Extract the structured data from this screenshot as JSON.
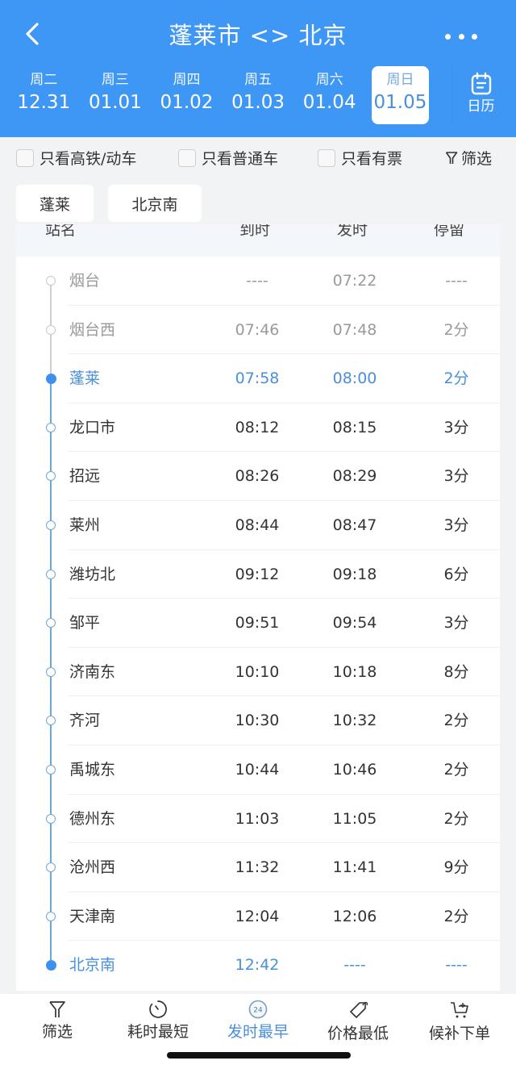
{
  "header": {
    "title": "蓬莱市 <> 北京",
    "back_icon": "chevron-left-icon",
    "more_icon": "more-dots-icon"
  },
  "dates": [
    {
      "weekday": "周二",
      "date": "12.31",
      "selected": false
    },
    {
      "weekday": "周三",
      "date": "01.01",
      "selected": false
    },
    {
      "weekday": "周四",
      "date": "01.02",
      "selected": false
    },
    {
      "weekday": "周五",
      "date": "01.03",
      "selected": false
    },
    {
      "weekday": "周六",
      "date": "01.04",
      "selected": false
    },
    {
      "weekday": "周日",
      "date": "01.05",
      "selected": true
    }
  ],
  "calendar": {
    "label": "日历",
    "icon": "calendar-icon"
  },
  "filters": {
    "high_speed": {
      "label": "只看高铁/动车",
      "checked": false
    },
    "normal": {
      "label": "只看普通车",
      "checked": false
    },
    "available": {
      "label": "只看有票",
      "checked": false
    },
    "filter_label": "筛选"
  },
  "stations": {
    "from": "蓬莱",
    "to": "北京南"
  },
  "table": {
    "headers": {
      "name": "站名",
      "arrive": "到时",
      "depart": "发时",
      "stay": "停留"
    },
    "rows": [
      {
        "name": "烟台",
        "arrive": "----",
        "depart": "07:22",
        "stay": "----",
        "state": "past"
      },
      {
        "name": "烟台西",
        "arrive": "07:46",
        "depart": "07:48",
        "stay": "2分",
        "state": "past"
      },
      {
        "name": "蓬莱",
        "arrive": "07:58",
        "depart": "08:00",
        "stay": "2分",
        "state": "highlight"
      },
      {
        "name": "龙口市",
        "arrive": "08:12",
        "depart": "08:15",
        "stay": "3分",
        "state": "normal"
      },
      {
        "name": "招远",
        "arrive": "08:26",
        "depart": "08:29",
        "stay": "3分",
        "state": "normal"
      },
      {
        "name": "莱州",
        "arrive": "08:44",
        "depart": "08:47",
        "stay": "3分",
        "state": "normal"
      },
      {
        "name": "潍坊北",
        "arrive": "09:12",
        "depart": "09:18",
        "stay": "6分",
        "state": "normal"
      },
      {
        "name": "邹平",
        "arrive": "09:51",
        "depart": "09:54",
        "stay": "3分",
        "state": "normal"
      },
      {
        "name": "济南东",
        "arrive": "10:10",
        "depart": "10:18",
        "stay": "8分",
        "state": "normal"
      },
      {
        "name": "齐河",
        "arrive": "10:30",
        "depart": "10:32",
        "stay": "2分",
        "state": "normal"
      },
      {
        "name": "禹城东",
        "arrive": "10:44",
        "depart": "10:46",
        "stay": "2分",
        "state": "normal"
      },
      {
        "name": "德州东",
        "arrive": "11:03",
        "depart": "11:05",
        "stay": "2分",
        "state": "normal"
      },
      {
        "name": "沧州西",
        "arrive": "11:32",
        "depart": "11:41",
        "stay": "9分",
        "state": "normal"
      },
      {
        "name": "天津南",
        "arrive": "12:04",
        "depart": "12:06",
        "stay": "2分",
        "state": "normal"
      },
      {
        "name": "北京南",
        "arrive": "12:42",
        "depart": "----",
        "stay": "----",
        "state": "highlight"
      }
    ]
  },
  "tabbar": [
    {
      "label": "筛选",
      "icon": "filter-icon",
      "active": false
    },
    {
      "label": "耗时最短",
      "icon": "timer-icon",
      "active": false
    },
    {
      "label": "发时最早",
      "icon": "clock-24-icon",
      "active": true,
      "badge": "24"
    },
    {
      "label": "价格最低",
      "icon": "price-tag-icon",
      "active": false
    },
    {
      "label": "候补下单",
      "icon": "cart-add-icon",
      "active": false
    }
  ],
  "colors": {
    "primary": "#3e97f5",
    "highlight_text": "#4a90d9",
    "route_line": "#6fa8d0",
    "past_text": "#9a9a9a"
  }
}
